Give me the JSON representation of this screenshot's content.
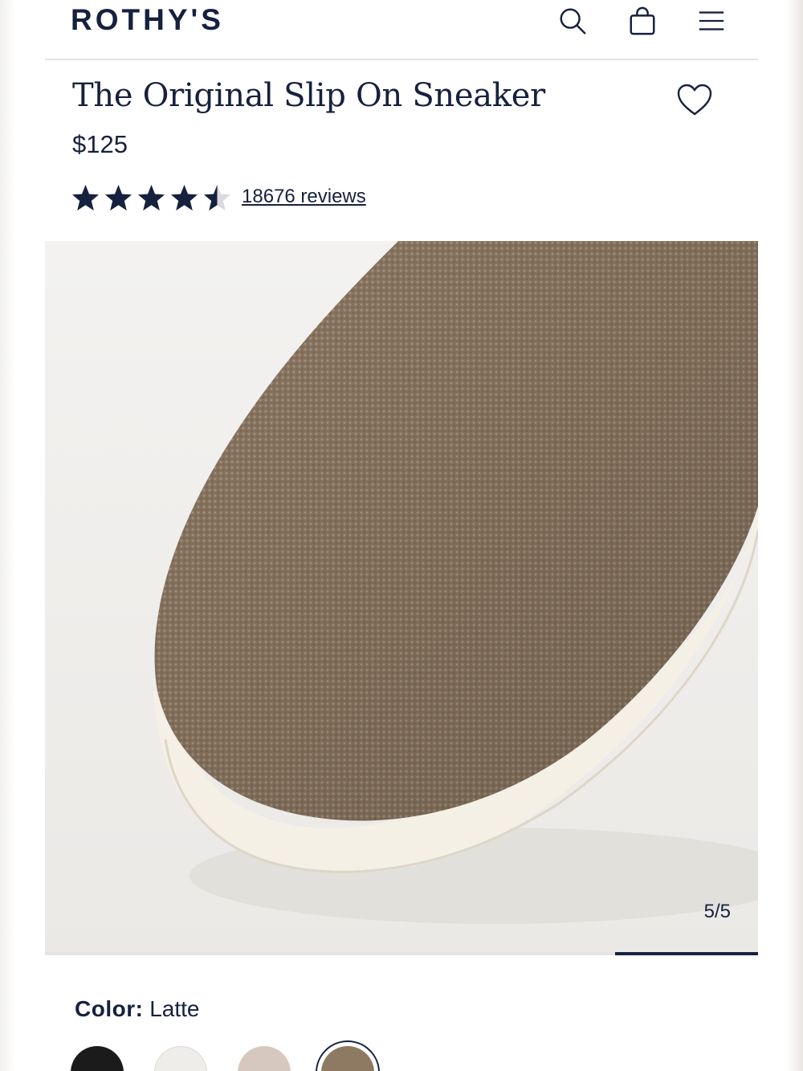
{
  "brand": {
    "logo_text": "ROTHY'S"
  },
  "header": {
    "icons": [
      "search-icon",
      "bag-icon",
      "menu-icon"
    ]
  },
  "product": {
    "name": "The Original Slip On Sneaker",
    "price": "$125",
    "rating": 4.5,
    "rating_max": 5,
    "reviews_label": "18676 reviews"
  },
  "gallery": {
    "counter": "5/5",
    "current_image": 5,
    "total_images": 5
  },
  "color": {
    "label": "Color:",
    "value": "Latte",
    "swatches": [
      {
        "name": "Black",
        "color": "#1b1b1b"
      },
      {
        "name": "White",
        "color": "#efedea"
      },
      {
        "name": "Blush",
        "color": "#d6c8bf"
      },
      {
        "name": "Latte",
        "color": "#8e7a63",
        "selected": true
      }
    ]
  },
  "colors": {
    "navy": "#16213f",
    "knit": "#8f7b65",
    "sole": "#f4f0e6"
  }
}
